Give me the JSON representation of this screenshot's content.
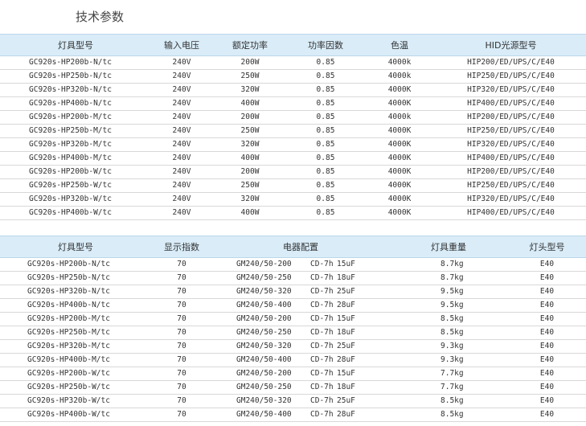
{
  "title": "技术参数",
  "table1": {
    "headers": [
      "灯具型号",
      "输入电压",
      "额定功率",
      "功率因数",
      "色温",
      "HID光源型号"
    ],
    "rows": [
      [
        "GC920s-HP200b-N/tc",
        "240V",
        "200W",
        "0.85",
        "4000k",
        "HIP200/ED/UPS/C/E40"
      ],
      [
        "GC920s-HP250b-N/tc",
        "240V",
        "250W",
        "0.85",
        "4000k",
        "HIP250/ED/UPS/C/E40"
      ],
      [
        "GC920s-HP320b-N/tc",
        "240V",
        "320W",
        "0.85",
        "4000K",
        "HIP320/ED/UPS/C/E40"
      ],
      [
        "GC920s-HP400b-N/tc",
        "240V",
        "400W",
        "0.85",
        "4000K",
        "HIP400/ED/UPS/C/E40"
      ],
      [
        "GC920s-HP200b-M/tc",
        "240V",
        "200W",
        "0.85",
        "4000k",
        "HIP200/ED/UPS/C/E40"
      ],
      [
        "GC920s-HP250b-M/tc",
        "240V",
        "250W",
        "0.85",
        "4000K",
        "HIP250/ED/UPS/C/E40"
      ],
      [
        "GC920s-HP320b-M/tc",
        "240V",
        "320W",
        "0.85",
        "4000K",
        "HIP320/ED/UPS/C/E40"
      ],
      [
        "GC920s-HP400b-M/tc",
        "240V",
        "400W",
        "0.85",
        "4000K",
        "HIP400/ED/UPS/C/E40"
      ],
      [
        "GC920s-HP200b-W/tc",
        "240V",
        "200W",
        "0.85",
        "4000K",
        "HIP200/ED/UPS/C/E40"
      ],
      [
        "GC920s-HP250b-W/tc",
        "240V",
        "250W",
        "0.85",
        "4000K",
        "HIP250/ED/UPS/C/E40"
      ],
      [
        "GC920s-HP320b-W/tc",
        "240V",
        "320W",
        "0.85",
        "4000K",
        "HIP320/ED/UPS/C/E40"
      ],
      [
        "GC920s-HP400b-W/tc",
        "240V",
        "400W",
        "0.85",
        "4000K",
        "HIP400/ED/UPS/C/E40"
      ]
    ]
  },
  "table2": {
    "headers": [
      "灯具型号",
      "显示指数",
      "电器配置",
      "灯具重量",
      "灯头型号"
    ],
    "rows": [
      [
        "GC920s-HP200b-N/tc",
        "70",
        "GM240/50-200",
        "CD-7h",
        "15uF",
        "8.7kg",
        "E40"
      ],
      [
        "GC920s-HP250b-N/tc",
        "70",
        "GM240/50-250",
        "CD-7h",
        "18uF",
        "8.7kg",
        "E40"
      ],
      [
        "GC920s-HP320b-N/tc",
        "70",
        "GM240/50-320",
        "CD-7h",
        "25uF",
        "9.5kg",
        "E40"
      ],
      [
        "GC920s-HP400b-N/tc",
        "70",
        "GM240/50-400",
        "CD-7h",
        "28uF",
        "9.5kg",
        "E40"
      ],
      [
        "GC920s-HP200b-M/tc",
        "70",
        "GM240/50-200",
        "CD-7h",
        "15uF",
        "8.5kg",
        "E40"
      ],
      [
        "GC920s-HP250b-M/tc",
        "70",
        "GM240/50-250",
        "CD-7h",
        "18uF",
        "8.5kg",
        "E40"
      ],
      [
        "GC920s-HP320b-M/tc",
        "70",
        "GM240/50-320",
        "CD-7h",
        "25uF",
        "9.3kg",
        "E40"
      ],
      [
        "GC920s-HP400b-M/tc",
        "70",
        "GM240/50-400",
        "CD-7h",
        "28uF",
        "9.3kg",
        "E40"
      ],
      [
        "GC920s-HP200b-W/tc",
        "70",
        "GM240/50-200",
        "CD-7h",
        "15uF",
        "7.7kg",
        "E40"
      ],
      [
        "GC920s-HP250b-W/tc",
        "70",
        "GM240/50-250",
        "CD-7h",
        "18uF",
        "7.7kg",
        "E40"
      ],
      [
        "GC920s-HP320b-W/tc",
        "70",
        "GM240/50-320",
        "CD-7h",
        "25uF",
        "8.5kg",
        "E40"
      ],
      [
        "GC920s-HP400b-W/tc",
        "70",
        "GM240/50-400",
        "CD-7h",
        "28uF",
        "8.5kg",
        "E40"
      ]
    ]
  }
}
